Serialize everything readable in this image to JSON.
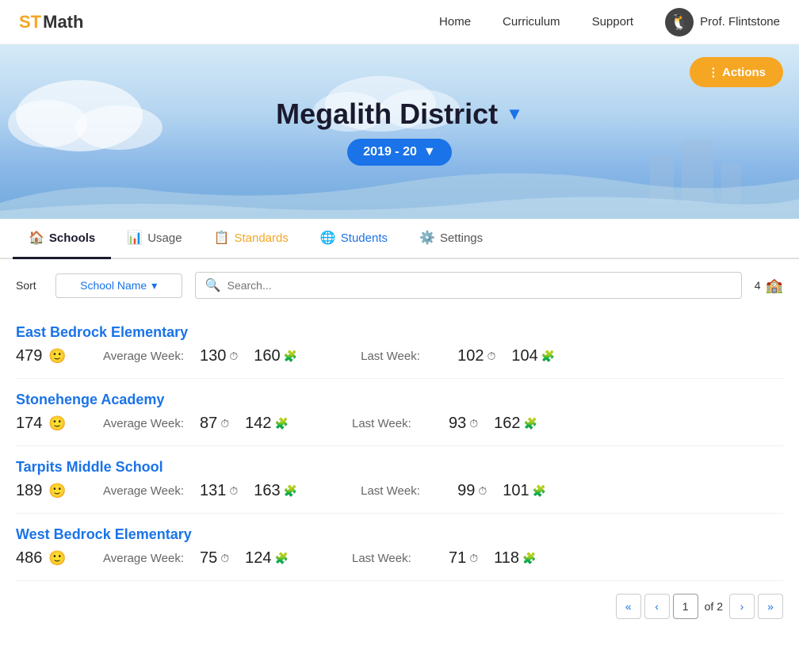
{
  "nav": {
    "logo_st": "ST",
    "logo_math": "Math",
    "links": [
      "Home",
      "Curriculum",
      "Support"
    ],
    "user_name": "Prof. Flintstone"
  },
  "hero": {
    "actions_label": "⋮  Actions",
    "district_name": "Megalith District",
    "year_label": "2019 - 20"
  },
  "tabs": [
    {
      "id": "schools",
      "label": "Schools",
      "icon": "🏠",
      "active": true
    },
    {
      "id": "usage",
      "label": "Usage",
      "icon": "📊",
      "active": false
    },
    {
      "id": "standards",
      "label": "Standards",
      "icon": "📋",
      "active": false
    },
    {
      "id": "students",
      "label": "Students",
      "icon": "🌐",
      "active": false
    },
    {
      "id": "settings",
      "label": "Settings",
      "icon": "⚙️",
      "active": false
    }
  ],
  "controls": {
    "sort_label": "Sort",
    "sort_value": "School Name",
    "search_placeholder": "Search...",
    "count": "4"
  },
  "schools": [
    {
      "name": "East Bedrock Elementary",
      "students": "479",
      "avg_week_label": "Average Week:",
      "avg_time": "130",
      "avg_puzzles": "160",
      "last_week_label": "Last Week:",
      "last_time": "102",
      "last_puzzles": "104"
    },
    {
      "name": "Stonehenge Academy",
      "students": "174",
      "avg_week_label": "Average Week:",
      "avg_time": "87",
      "avg_puzzles": "142",
      "last_week_label": "Last Week:",
      "last_time": "93",
      "last_puzzles": "162"
    },
    {
      "name": "Tarpits Middle School",
      "students": "189",
      "avg_week_label": "Average Week:",
      "avg_time": "131",
      "avg_puzzles": "163",
      "last_week_label": "Last Week:",
      "last_time": "99",
      "last_puzzles": "101"
    },
    {
      "name": "West Bedrock Elementary",
      "students": "486",
      "avg_week_label": "Average Week:",
      "avg_time": "75",
      "avg_puzzles": "124",
      "last_week_label": "Last Week:",
      "last_time": "71",
      "last_puzzles": "118"
    }
  ],
  "pagination": {
    "current_page": "1",
    "of_label": "of 2"
  }
}
